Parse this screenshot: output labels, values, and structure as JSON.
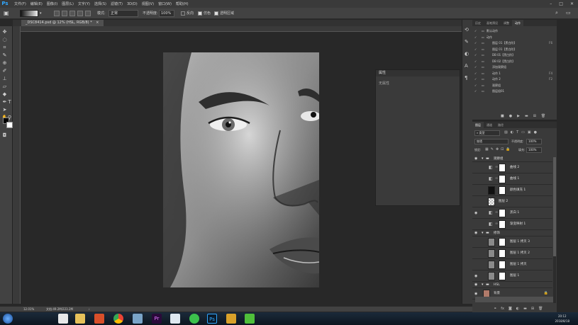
{
  "app": {
    "logo": "Ps"
  },
  "menubar": {
    "items": [
      "文件(F)",
      "编辑(E)",
      "图像(I)",
      "图层(L)",
      "文字(Y)",
      "选择(S)",
      "滤镜(T)",
      "3D(D)",
      "视图(V)",
      "窗口(W)",
      "帮助(H)"
    ]
  },
  "options": {
    "mode_label": "模式:",
    "mode_value": "正常",
    "opacity_label": "不透明度:",
    "opacity_value": "100%",
    "reverse": "反向",
    "dither": "仿色",
    "transparency": "透明区域"
  },
  "document": {
    "tab_title": "_DSC8414.psd @ 12% (HSL, RGB/8) *",
    "zoom": "12.01%",
    "docsize": "文档:49.2M/223.2M"
  },
  "properties": {
    "title": "属性",
    "subtitle": "无属性"
  },
  "actions_panel": {
    "tabs": [
      "历史",
      "画笔预设",
      "调整",
      "动作"
    ],
    "rows": [
      {
        "label": "默认动作",
        "shortcut": ""
      },
      {
        "label": "动作",
        "shortcut": ""
      },
      {
        "label": "图层 01【黑白阶】",
        "shortcut": "F6"
      },
      {
        "label": "图层 01【黑白阶】",
        "shortcut": ""
      },
      {
        "label": "DB 01【黑白阶】",
        "shortcut": ""
      },
      {
        "label": "DB 02【黑白阶】",
        "shortcut": ""
      },
      {
        "label": "添加观察组",
        "shortcut": ""
      },
      {
        "label": "动作 1",
        "shortcut": "F4"
      },
      {
        "label": "动作 2",
        "shortcut": "F2"
      },
      {
        "label": "观察组",
        "shortcut": ""
      },
      {
        "label": "图层组01",
        "shortcut": ""
      }
    ]
  },
  "layers_panel": {
    "tabs": [
      "图层",
      "通道",
      "路径"
    ],
    "kind_label": "类型",
    "blend_mode": "穿透",
    "opacity_label": "不透明度:",
    "opacity_value": "100%",
    "lock_label": "锁定:",
    "fill_label": "填充:",
    "fill_value": "100%",
    "layers": [
      {
        "name": "观察组",
        "type": "group",
        "eye": true
      },
      {
        "name": "曲线 2",
        "type": "adj",
        "eye": false
      },
      {
        "name": "曲线 1",
        "type": "adj",
        "eye": false
      },
      {
        "name": "颜色填充 1",
        "type": "fill",
        "eye": false
      },
      {
        "name": "图层 2",
        "type": "layer",
        "eye": false
      },
      {
        "name": "黑白 1",
        "type": "adj",
        "eye": true
      },
      {
        "name": "渐变映射 1",
        "type": "adj",
        "eye": false
      },
      {
        "name": "修饰",
        "type": "group",
        "eye": true
      },
      {
        "name": "图层 1 拷贝 3",
        "type": "layer",
        "eye": false
      },
      {
        "name": "图层 1 拷贝 2",
        "type": "layer",
        "eye": false
      },
      {
        "name": "图层 1 拷贝",
        "type": "layer",
        "eye": false
      },
      {
        "name": "图层 1",
        "type": "layer",
        "eye": true
      },
      {
        "name": "HSL",
        "type": "group",
        "eye": true
      },
      {
        "name": "背景",
        "type": "bg",
        "eye": true
      }
    ]
  },
  "taskbar": {
    "time": "20:12",
    "date": "2018/8/18"
  }
}
